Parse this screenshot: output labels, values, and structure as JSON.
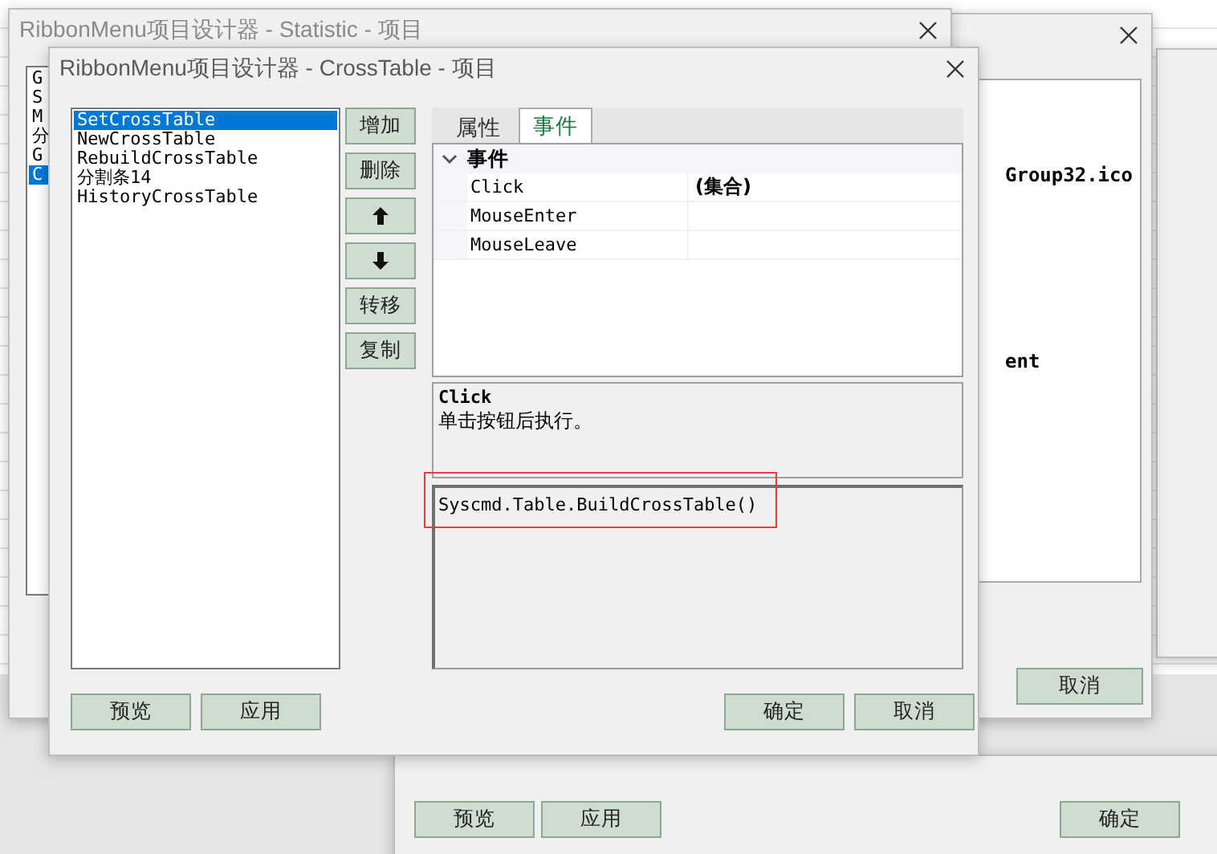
{
  "statistic_window": {
    "title": "RibbonMenu项目设计器 - Statistic - 项目",
    "items": [
      {
        "label": "G",
        "selected": false
      },
      {
        "label": "S",
        "selected": false
      },
      {
        "label": "M",
        "selected": false
      },
      {
        "label": "分",
        "selected": false
      },
      {
        "label": "G",
        "selected": false
      },
      {
        "label": "C",
        "selected": true
      }
    ]
  },
  "right_window": {
    "cells": [
      "Group32.ico",
      "ent"
    ],
    "buttons": [
      "取消"
    ]
  },
  "bottom_window": {
    "buttons": [
      "预览",
      "应用",
      "确定"
    ]
  },
  "window": {
    "title": "RibbonMenu项目设计器 - CrossTable - 项目",
    "items": [
      {
        "label": "SetCrossTable",
        "selected": true
      },
      {
        "label": "NewCrossTable",
        "selected": false
      },
      {
        "label": "RebuildCrossTable",
        "selected": false
      },
      {
        "label": "分割条14",
        "selected": false
      },
      {
        "label": "HistoryCrossTable",
        "selected": false
      }
    ],
    "side_buttons": [
      {
        "kind": "text",
        "label": "增加"
      },
      {
        "kind": "text",
        "label": "删除"
      },
      {
        "kind": "up"
      },
      {
        "kind": "down"
      },
      {
        "kind": "text",
        "label": "转移"
      },
      {
        "kind": "text",
        "label": "复制"
      }
    ],
    "tabs": [
      {
        "label": "属性",
        "selected": false
      },
      {
        "label": "事件",
        "selected": true
      }
    ],
    "property_grid": {
      "category": "事件",
      "expanded": true,
      "rows": [
        {
          "name": "Click",
          "value": "(集合)"
        },
        {
          "name": "MouseEnter"
        },
        {
          "name": "MouseLeave"
        }
      ]
    },
    "description": {
      "title": "Click",
      "text": "单击按钮后执行。"
    },
    "code": "Syscmd.Table.BuildCrossTable()",
    "code_highlighted": true,
    "left_buttons": [
      "预览",
      "应用"
    ],
    "right_buttons": [
      "确定",
      "取消"
    ]
  }
}
